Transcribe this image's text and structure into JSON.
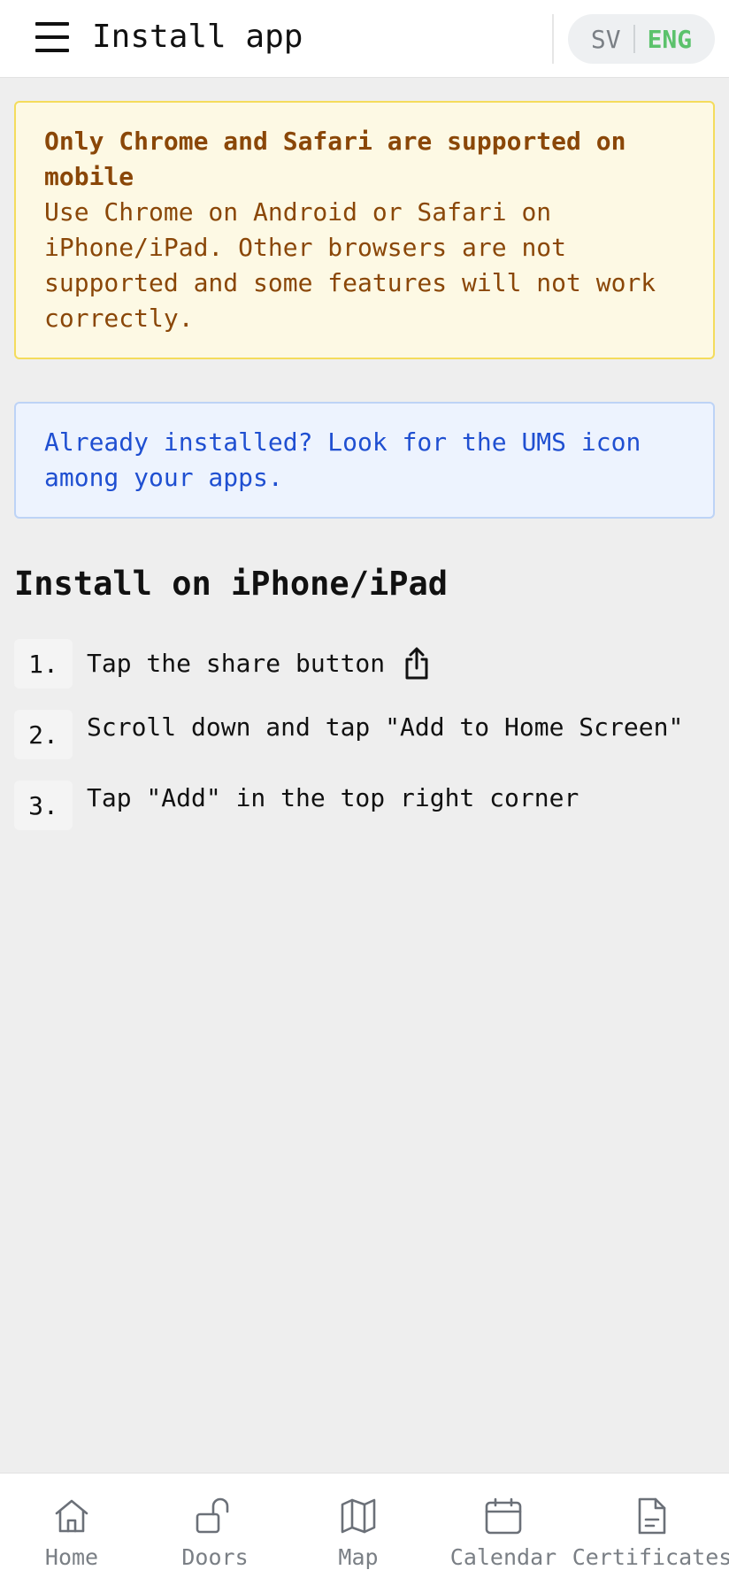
{
  "header": {
    "title": "Install app",
    "menu_icon": "hamburger-menu-icon",
    "lang_options": [
      "SV",
      "ENG"
    ],
    "lang_active": "ENG",
    "active_color": "#5cc26c"
  },
  "warning": {
    "title": "Only Chrome and Safari are supported on mobile",
    "body": "Use Chrome on Android or Safari on iPhone/iPad. Other browsers are not supported and some features will not work correctly.",
    "text_color": "#8a4708",
    "bg_color": "#fdf9e4",
    "border_color": "#f4dc5c"
  },
  "info": {
    "text": "Already installed? Look for the UMS icon among your apps.",
    "text_color": "#1f4fd1",
    "bg_color": "#edf3fe"
  },
  "install": {
    "title": "Install on iPhone/iPad",
    "steps": [
      {
        "number": "1.",
        "text": "Tap the share button",
        "icon": "share-icon"
      },
      {
        "number": "2.",
        "text": "Scroll down and tap \"Add to Home Screen\""
      },
      {
        "number": "3.",
        "text": "Tap \"Add\" in the top right corner"
      }
    ]
  },
  "bottom_nav": {
    "items": [
      {
        "label": "Home",
        "icon": "home-icon"
      },
      {
        "label": "Doors",
        "icon": "unlocked-padlock-icon"
      },
      {
        "label": "Map",
        "icon": "map-icon"
      },
      {
        "label": "Calendar",
        "icon": "calendar-icon"
      },
      {
        "label": "Certificates",
        "icon": "document-icon"
      }
    ]
  }
}
